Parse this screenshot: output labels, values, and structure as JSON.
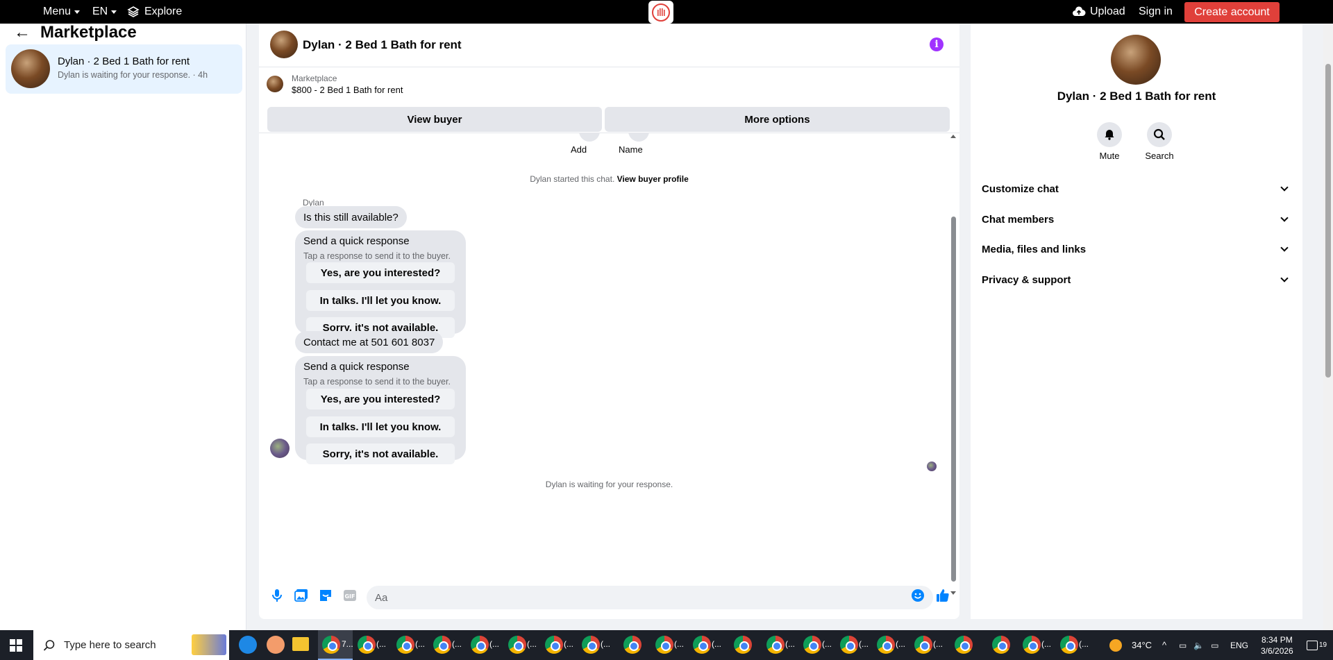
{
  "topbar": {
    "menu": "Menu",
    "lang": "EN",
    "explore": "Explore",
    "upload": "Upload",
    "signin": "Sign in",
    "create": "Create account"
  },
  "sidebar": {
    "heading": "Marketplace",
    "conversation": {
      "title": "Dylan · 2 Bed 1 Bath for rent",
      "preview": "Dylan is waiting for your response. · 4h"
    }
  },
  "chat": {
    "header_title": "Dylan · 2 Bed 1 Bath for rent",
    "listing_source": "Marketplace",
    "listing_desc": "$800 - 2 Bed 1 Bath for rent",
    "view_buyer": "View buyer",
    "more_options": "More options",
    "add_label": "Add",
    "name_label": "Name",
    "started_text": "Dylan started this chat.",
    "view_buyer_profile": "View buyer profile",
    "sender": "Dylan",
    "messages": {
      "first": "Is this still available?",
      "contact": "Contact me at 501 601 8037"
    },
    "quick_response": {
      "title": "Send a quick response",
      "subtitle": "Tap a response to send it to the buyer.",
      "options": [
        "Yes, are you interested?",
        "In talks. I'll let you know.",
        "Sorry, it's not available."
      ]
    },
    "waiting": "Dylan is waiting for your response.",
    "composer_placeholder": "Aa"
  },
  "right_panel": {
    "name": "Dylan · 2 Bed 1 Bath for rent",
    "mute": "Mute",
    "search": "Search",
    "sections": [
      "Customize chat",
      "Chat members",
      "Media, files and links",
      "Privacy & support"
    ]
  },
  "taskbar": {
    "search_placeholder": "Type here to search",
    "active_app_label": "7...",
    "tab_label": "(...",
    "temperature": "34°C",
    "lang": "ENG",
    "time": "8:34 PM",
    "date": "3/6/2026",
    "notif_count": "19"
  },
  "colors": {
    "accent": "#0084ff",
    "brand_red": "#e0403a",
    "info_purple": "#a033ff"
  }
}
